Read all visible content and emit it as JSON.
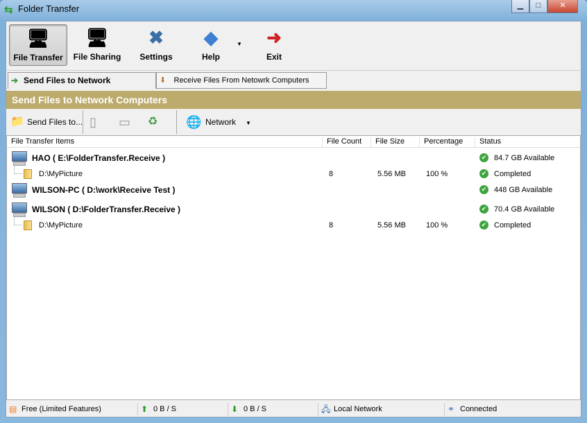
{
  "window": {
    "title": "Folder Transfer",
    "minimize": "▁",
    "maximize": "□",
    "close": "✕"
  },
  "toolbar": [
    {
      "label": "File Transfer",
      "selected": true
    },
    {
      "label": "File Sharing"
    },
    {
      "label": "Settings"
    },
    {
      "label": "Help"
    },
    {
      "label": "Exit"
    }
  ],
  "tabs": [
    {
      "label": "Send Files to Network Computers",
      "active": true
    },
    {
      "label": "Receive Files From Netowrk Computers"
    }
  ],
  "banner": "Send Files to Network Computers",
  "actions": {
    "send": "Send Files to...",
    "network": "Network"
  },
  "columns": [
    "File Transfer Items",
    "File Count",
    "File Size",
    "Percentage",
    "Status"
  ],
  "rows": [
    {
      "type": "computer",
      "name": "HAO ( E:\\FolderTransfer.Receive )",
      "status": "84.7 GB Available"
    },
    {
      "type": "folder",
      "name": "D:\\MyPicture",
      "count": "8",
      "size": "5.56 MB",
      "percent": "100 %",
      "status": "Completed"
    },
    {
      "type": "computer",
      "name": "WILSON-PC ( D:\\work\\Receive Test )",
      "status": "448 GB Available"
    },
    {
      "type": "computer",
      "name": "WILSON ( D:\\FolderTransfer.Receive )",
      "status": "70.4 GB Available"
    },
    {
      "type": "folder",
      "name": "D:\\MyPicture",
      "count": "8",
      "size": "5.56 MB",
      "percent": "100 %",
      "status": "Completed"
    }
  ],
  "statusbar": {
    "license": "Free (Limited Features)",
    "upload": "0 B / S",
    "download": "0 B / S",
    "network": "Local Network",
    "connection": "Connected"
  },
  "colors": {
    "banner": "#bcab6d",
    "status_ok": "#3ea43e"
  }
}
